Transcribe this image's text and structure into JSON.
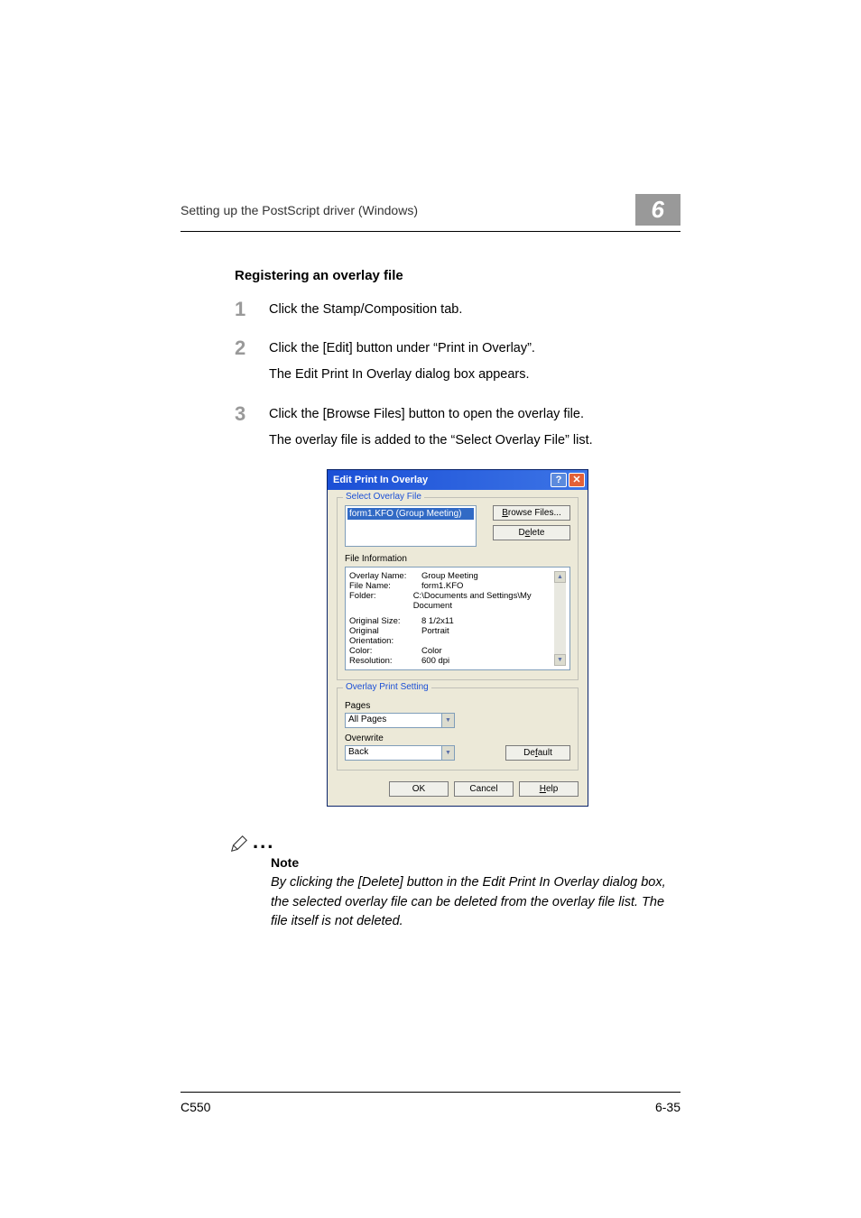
{
  "header": {
    "left": "Setting up the PostScript driver (Windows)",
    "chapter": "6"
  },
  "section": {
    "title": "Registering an overlay file"
  },
  "steps": [
    {
      "num": "1",
      "lines": [
        "Click the Stamp/Composition tab."
      ]
    },
    {
      "num": "2",
      "lines": [
        "Click the [Edit] button under “Print in Overlay”.",
        "The Edit Print In Overlay dialog box appears."
      ]
    },
    {
      "num": "3",
      "lines": [
        "Click the [Browse Files] button to open the overlay file.",
        "The overlay file is added to the “Select Overlay File” list."
      ]
    }
  ],
  "dialog": {
    "title": "Edit Print In Overlay",
    "group1": {
      "title": "Select Overlay File",
      "selected": "form1.KFO (Group Meeting)",
      "browse": "Browse Files...",
      "delete": "Delete",
      "file_info_label": "File Information",
      "info": {
        "overlay_name_l": "Overlay Name:",
        "overlay_name": "Group Meeting",
        "file_name_l": "File Name:",
        "file_name": "form1.KFO",
        "folder_l": "Folder:",
        "folder": "C:\\Documents and Settings\\My Document",
        "size_l": "Original Size:",
        "size": "8 1/2x11",
        "orient_l": "Original Orientation:",
        "orient": "Portrait",
        "color_l": "Color:",
        "color": "Color",
        "res_l": "Resolution:",
        "res": "600 dpi"
      }
    },
    "group2": {
      "title": "Overlay Print Setting",
      "pages_label": "Pages",
      "pages_value": "All Pages",
      "overwrite_label": "Overwrite",
      "overwrite_value": "Back",
      "default": "Default"
    },
    "buttons": {
      "ok": "OK",
      "cancel": "Cancel",
      "help": "Help"
    }
  },
  "note": {
    "label": "Note",
    "text": "By clicking the [Delete] button in the Edit Print In Overlay dialog box, the selected overlay file can be deleted from the overlay file list. The file itself is not deleted."
  },
  "footer": {
    "left": "C550",
    "right": "6-35"
  }
}
